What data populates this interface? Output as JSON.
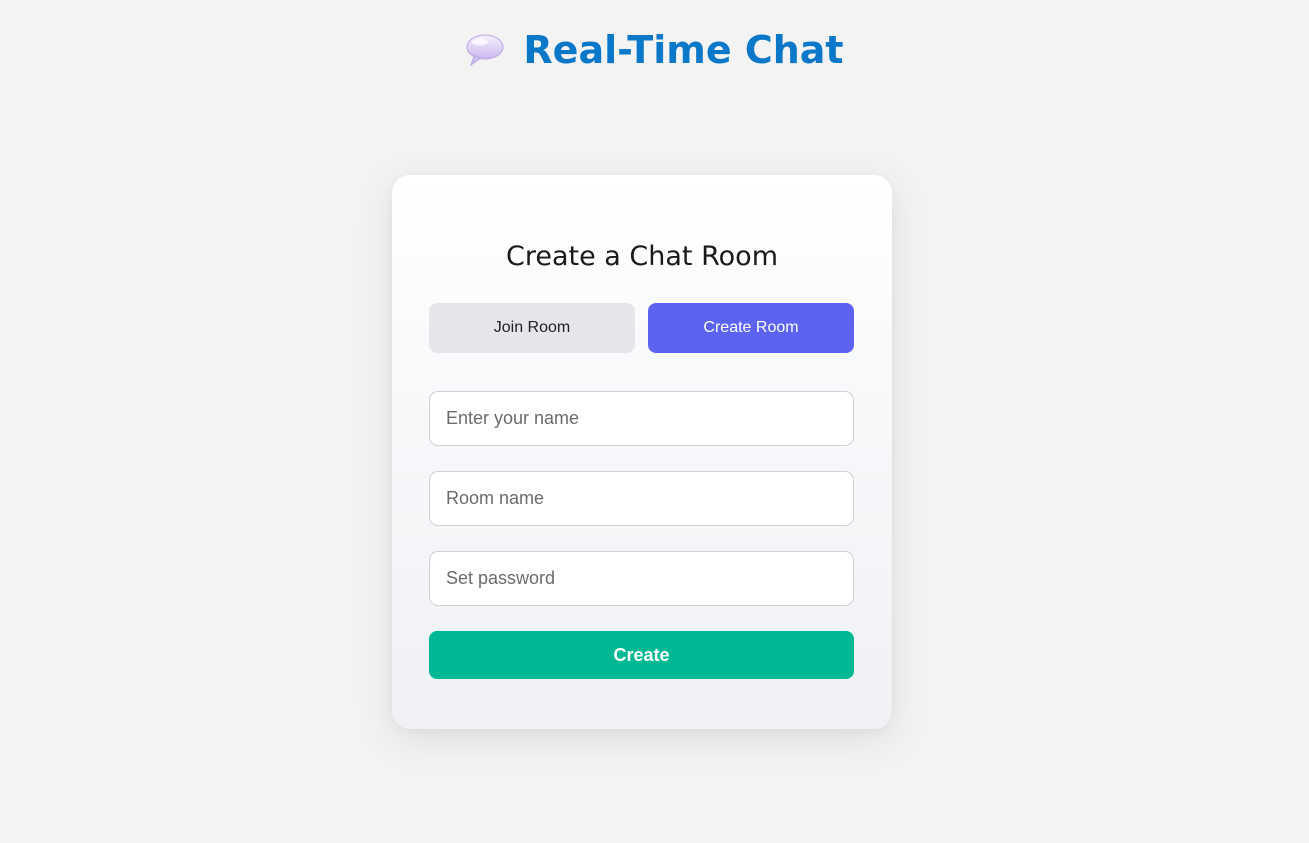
{
  "header": {
    "title": "Real-Time Chat",
    "icon": "speech-bubble-icon"
  },
  "card": {
    "title": "Create a Chat Room",
    "tabs": [
      {
        "label": "Join Room",
        "active": false
      },
      {
        "label": "Create Room",
        "active": true
      }
    ],
    "fields": {
      "name_placeholder": "Enter your name",
      "name_value": "",
      "room_placeholder": "Room name",
      "room_value": "",
      "password_placeholder": "Set password",
      "password_value": ""
    },
    "submit_label": "Create"
  },
  "colors": {
    "title": "#0a78c9",
    "active_tab": "#5b63f0",
    "inactive_tab": "#e4e6eb",
    "submit": "#00b894",
    "background": "#f3f3f3"
  }
}
